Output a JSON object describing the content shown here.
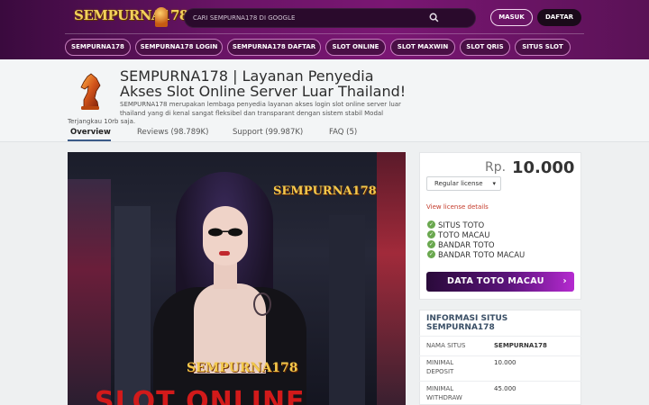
{
  "header": {
    "logo_text": "SEMPURNA178",
    "search_placeholder": "CARI SEMPURNA178 DI GOOGLE",
    "login_label": "MASUK",
    "register_label": "DAFTAR",
    "nav": [
      "SEMPURNA178",
      "SEMPURNA178 LOGIN",
      "SEMPURNA178 DAFTAR",
      "SLOT ONLINE",
      "SLOT MAXWIN",
      "SLOT QRIS",
      "SITUS SLOT"
    ]
  },
  "product": {
    "title": "SEMPURNA178 | Layanan Penyedia Akses Slot Online Server Luar Thailand!",
    "description_line1": "SEMPURNA178 merupakan lembaga penyedia layanan akses login slot online server luar thailand yang di kenal sangat fleksibel dan transparant dengan sistem stabil Modal",
    "description_line2": "Terjangkau 10rb saja.",
    "tabs": [
      "Overview",
      "Reviews (98.789K)",
      "Support (99.987K)",
      "FAQ (5)"
    ]
  },
  "banner": {
    "logo_top": "SEMPURNA178",
    "logo_bottom": "SEMPURNA178",
    "headline": "SLOT ONLINE"
  },
  "pricing": {
    "currency": "Rp.",
    "amount": "10.000",
    "license_select": "Regular license",
    "view_license": "View license details",
    "features": [
      "SITUS TOTO",
      "TOTO MACAU",
      "BANDAR TOTO",
      "BANDAR TOTO MACAU"
    ],
    "cta": "DATA TOTO MACAU"
  },
  "info": {
    "title": "INFORMASI SITUS SEMPURNA178",
    "rows": [
      {
        "label": "NAMA SITUS",
        "value": "SEMPURNA178"
      },
      {
        "label": "MINIMAL DEPOSIT",
        "value": "10.000"
      },
      {
        "label": "MINIMAL WITHDRAW",
        "value": "45.000"
      }
    ]
  }
}
